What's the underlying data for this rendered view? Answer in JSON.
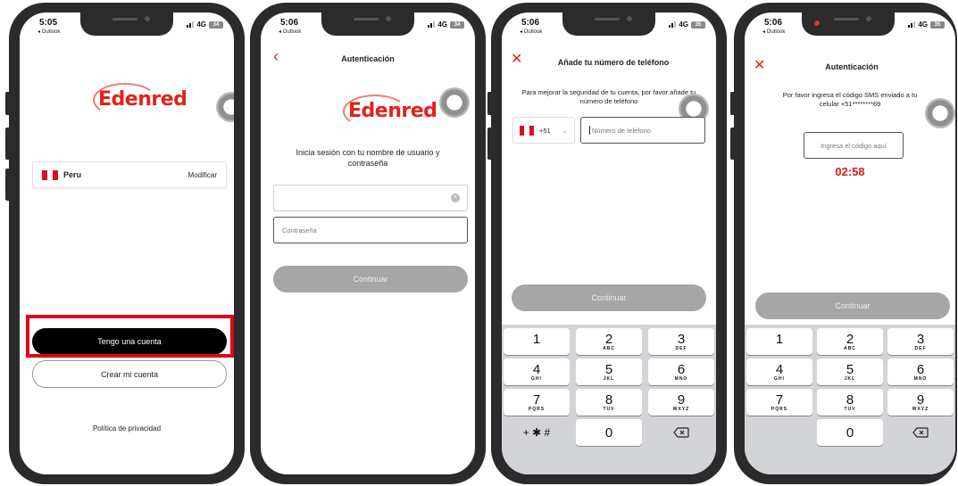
{
  "colors": {
    "brand": "#e2231a",
    "timer": "#d0211b",
    "highlight": "#e2001a"
  },
  "screens": [
    {
      "status": {
        "time": "5:05",
        "back": "◂ Outlook",
        "network": "4G",
        "battery": "34"
      },
      "logo": "Edenred",
      "country": {
        "name": "Peru",
        "modify": "Modificar"
      },
      "primary_button": "Tengo una cuenta",
      "secondary_button": "Crear mi cuenta",
      "privacy_link": "Política de privacidad"
    },
    {
      "status": {
        "time": "5:06",
        "back": "◂ Outlook",
        "network": "4G",
        "battery": "34"
      },
      "title": "Autenticación",
      "logo": "Edenred",
      "instruction": "Inicia sesión con tu nombre de usuario y contraseña",
      "username_value": "",
      "password_placeholder": "Contraseña",
      "continue_button": "Continuar"
    },
    {
      "status": {
        "time": "5:06",
        "back": "◂ Outlook",
        "network": "4G",
        "battery": "35"
      },
      "title": "Añade tu número de teléfono",
      "instruction": "Para mejorar la seguridad de tu cuenta, por favor añade tu número de teléfono",
      "prefix": "+51",
      "phone_placeholder": "Número de teléfono",
      "continue_button": "Continuar"
    },
    {
      "status": {
        "time": "5:06",
        "back": "◂ Outlook",
        "network": "4G",
        "battery": "35"
      },
      "title": "Autenticación",
      "instruction": "Por favor ingresa el código SMS enviado a tu celular +51********69",
      "code_placeholder": "Ingresa el código aquí",
      "timer": "02:58",
      "continue_button": "Continuar"
    }
  ],
  "keypad": {
    "keys": [
      {
        "n": "1",
        "l": ""
      },
      {
        "n": "2",
        "l": "ABC"
      },
      {
        "n": "3",
        "l": "DEF"
      },
      {
        "n": "4",
        "l": "GHI"
      },
      {
        "n": "5",
        "l": "JKL"
      },
      {
        "n": "6",
        "l": "MNO"
      },
      {
        "n": "7",
        "l": "PQRS"
      },
      {
        "n": "8",
        "l": "TUV"
      },
      {
        "n": "9",
        "l": "WXYZ"
      },
      {
        "n": "0",
        "l": ""
      }
    ],
    "symbols": "+ ✱ #",
    "delete_icon": "backspace-icon"
  }
}
